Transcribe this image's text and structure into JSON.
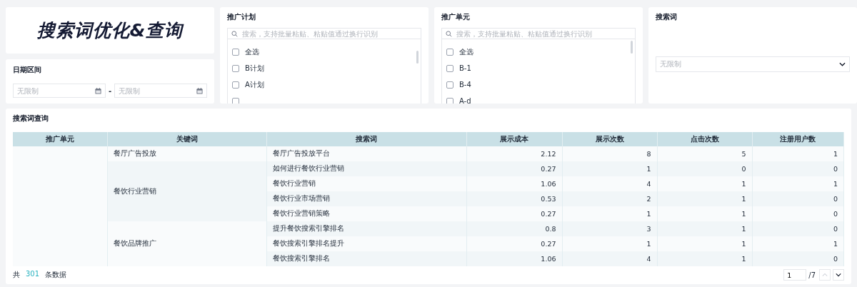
{
  "title": "搜索词优化&查询",
  "date_range": {
    "label": "日期区间",
    "start": {
      "placeholder": "无限制"
    },
    "separator": "-",
    "end": {
      "placeholder": "无限制"
    }
  },
  "filters": [
    {
      "label": "推广计划",
      "search": {
        "placeholder": "搜索，支持批量粘贴、粘贴值通过换行识别"
      },
      "items": [
        {
          "label": "全选",
          "checked": false
        },
        {
          "label": "B计划",
          "checked": false
        },
        {
          "label": "A计划",
          "checked": false
        },
        {
          "checked": false
        }
      ]
    },
    {
      "label": "推广单元",
      "search": {
        "placeholder": "搜索，支持批量粘贴、粘贴值通过换行识别"
      },
      "items": [
        {
          "label": "全选",
          "checked": false
        },
        {
          "label": "B-1",
          "checked": false
        },
        {
          "label": "B-4",
          "checked": false
        },
        {
          "label": "A-d",
          "checked": false
        }
      ]
    }
  ],
  "search_term": {
    "label": "搜索词",
    "select": {
      "placeholder": "无限制"
    }
  },
  "query": {
    "title": "搜索词查询",
    "columns": [
      "推广单元",
      "关键词",
      "搜索词",
      "展示成本",
      "展示次数",
      "点击次数",
      "注册用户数"
    ],
    "groups": [
      {
        "keyword": "餐厅广告投放",
        "rows": [
          [
            "餐厅广告投放平台",
            "2.12",
            "8",
            "5",
            "1"
          ]
        ]
      },
      {
        "keyword": "餐饮行业营销",
        "rows": [
          [
            "如何进行餐饮行业营销",
            "0.27",
            "1",
            "0",
            "0"
          ],
          [
            "餐饮行业营销",
            "1.06",
            "4",
            "1",
            "1"
          ],
          [
            "餐饮行业市场营销",
            "0.53",
            "2",
            "1",
            "0"
          ],
          [
            "餐饮行业营销策略",
            "0.27",
            "1",
            "1",
            "0"
          ]
        ]
      },
      {
        "keyword": "餐饮品牌推广",
        "rows": [
          [
            "提升餐饮搜索引擎排名",
            "0.8",
            "3",
            "1",
            "0"
          ],
          [
            "餐饮搜索引擎排名提升",
            "0.27",
            "1",
            "1",
            "1"
          ],
          [
            "餐饮搜索引擎排名",
            "1.06",
            "4",
            "1",
            "0"
          ]
        ]
      }
    ],
    "footer": {
      "prefix": "共",
      "count": "301",
      "suffix": "条数据"
    },
    "pager": {
      "page": "1",
      "total": "/7",
      "prev_disabled": true,
      "next_disabled": false
    }
  }
}
